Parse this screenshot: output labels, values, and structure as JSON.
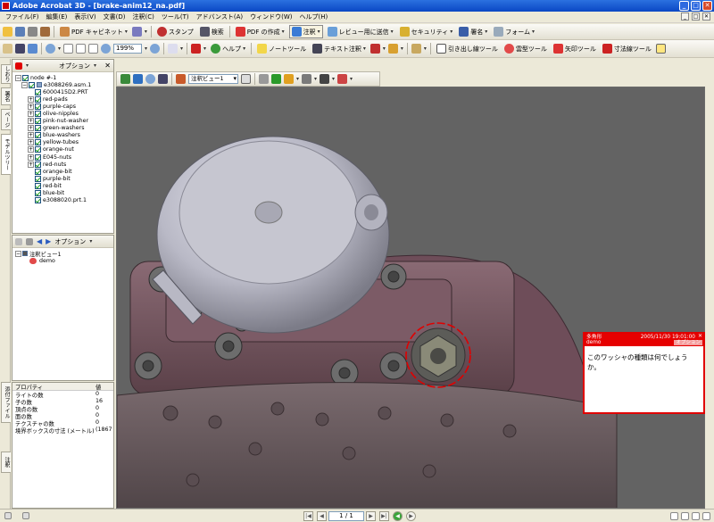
{
  "window": {
    "title": "Adobe Acrobat 3D - [brake-anim12_na.pdf]"
  },
  "menu": [
    "ファイル(F)",
    "編集(E)",
    "表示(V)",
    "文書(D)",
    "注釈(C)",
    "ツール(T)",
    "アドバンスト(A)",
    "ウィンドウ(W)",
    "ヘルプ(H)"
  ],
  "toolbar1": {
    "pdf_catalog": "PDF キャビネット",
    "stamp": "スタンプ",
    "search": "検索",
    "create_pdf": "PDF の作成",
    "annot": "注釈",
    "send_review": "レビュー用に送信",
    "security": "セキュリティ",
    "sign": "署名",
    "form": "フォーム"
  },
  "toolbar2": {
    "zoom_level": "199%",
    "help": "ヘルプ",
    "note_tool": "ノートツール",
    "text_annot": "テキスト注釈",
    "callout": "引き出し線ツール",
    "cloud": "雲型ツール",
    "arrow": "矢印ツール",
    "dimension": "寸法線ツール"
  },
  "left_tabs": [
    "しおり",
    "署名",
    "ページ",
    "モデルツリー",
    "添付ファイル",
    "注釈"
  ],
  "model_tree": {
    "options_label": "オプション",
    "root": "node #-1",
    "assembly": "e3088269.asm.1",
    "children": [
      "6000415D2.PRT",
      "red-pads",
      "purple-caps",
      "olive-nipples",
      "pink-nut-washer",
      "green-washers",
      "blue-washers",
      "yellow-tubes",
      "orange-nut",
      "E045-nuts",
      "red-nuts",
      "orange-bit",
      "purple-bit",
      "red-bit",
      "blue-bit",
      "e3088020.prt.1"
    ]
  },
  "views_panel": {
    "options_label": "オプション",
    "view_name": "注釈ビュー1",
    "item": "demo"
  },
  "properties": {
    "header_key": "プロパティ",
    "header_value": "値",
    "rows": [
      {
        "k": "ライトの数",
        "v": "0"
      },
      {
        "k": "子の数",
        "v": "16"
      },
      {
        "k": "頂点の数",
        "v": "0"
      },
      {
        "k": "面の数",
        "v": "0"
      },
      {
        "k": "テクスチャの数",
        "v": "0"
      },
      {
        "k": "境界ボックスの寸法 (メートル)",
        "v": "(1867"
      }
    ]
  },
  "viewer": {
    "view_select": "注釈ビュー1"
  },
  "comment": {
    "type": "多角形",
    "author": "demo",
    "date": "2005/11/30 19:01:00",
    "options": "オプション",
    "text": "このワッシャの種類は何でしょうか。"
  },
  "status": {
    "page": "1 / 1"
  },
  "colors": {
    "accent": "#e60000",
    "viewport_bg": "#636363",
    "title_blue": "#0a47c4"
  }
}
